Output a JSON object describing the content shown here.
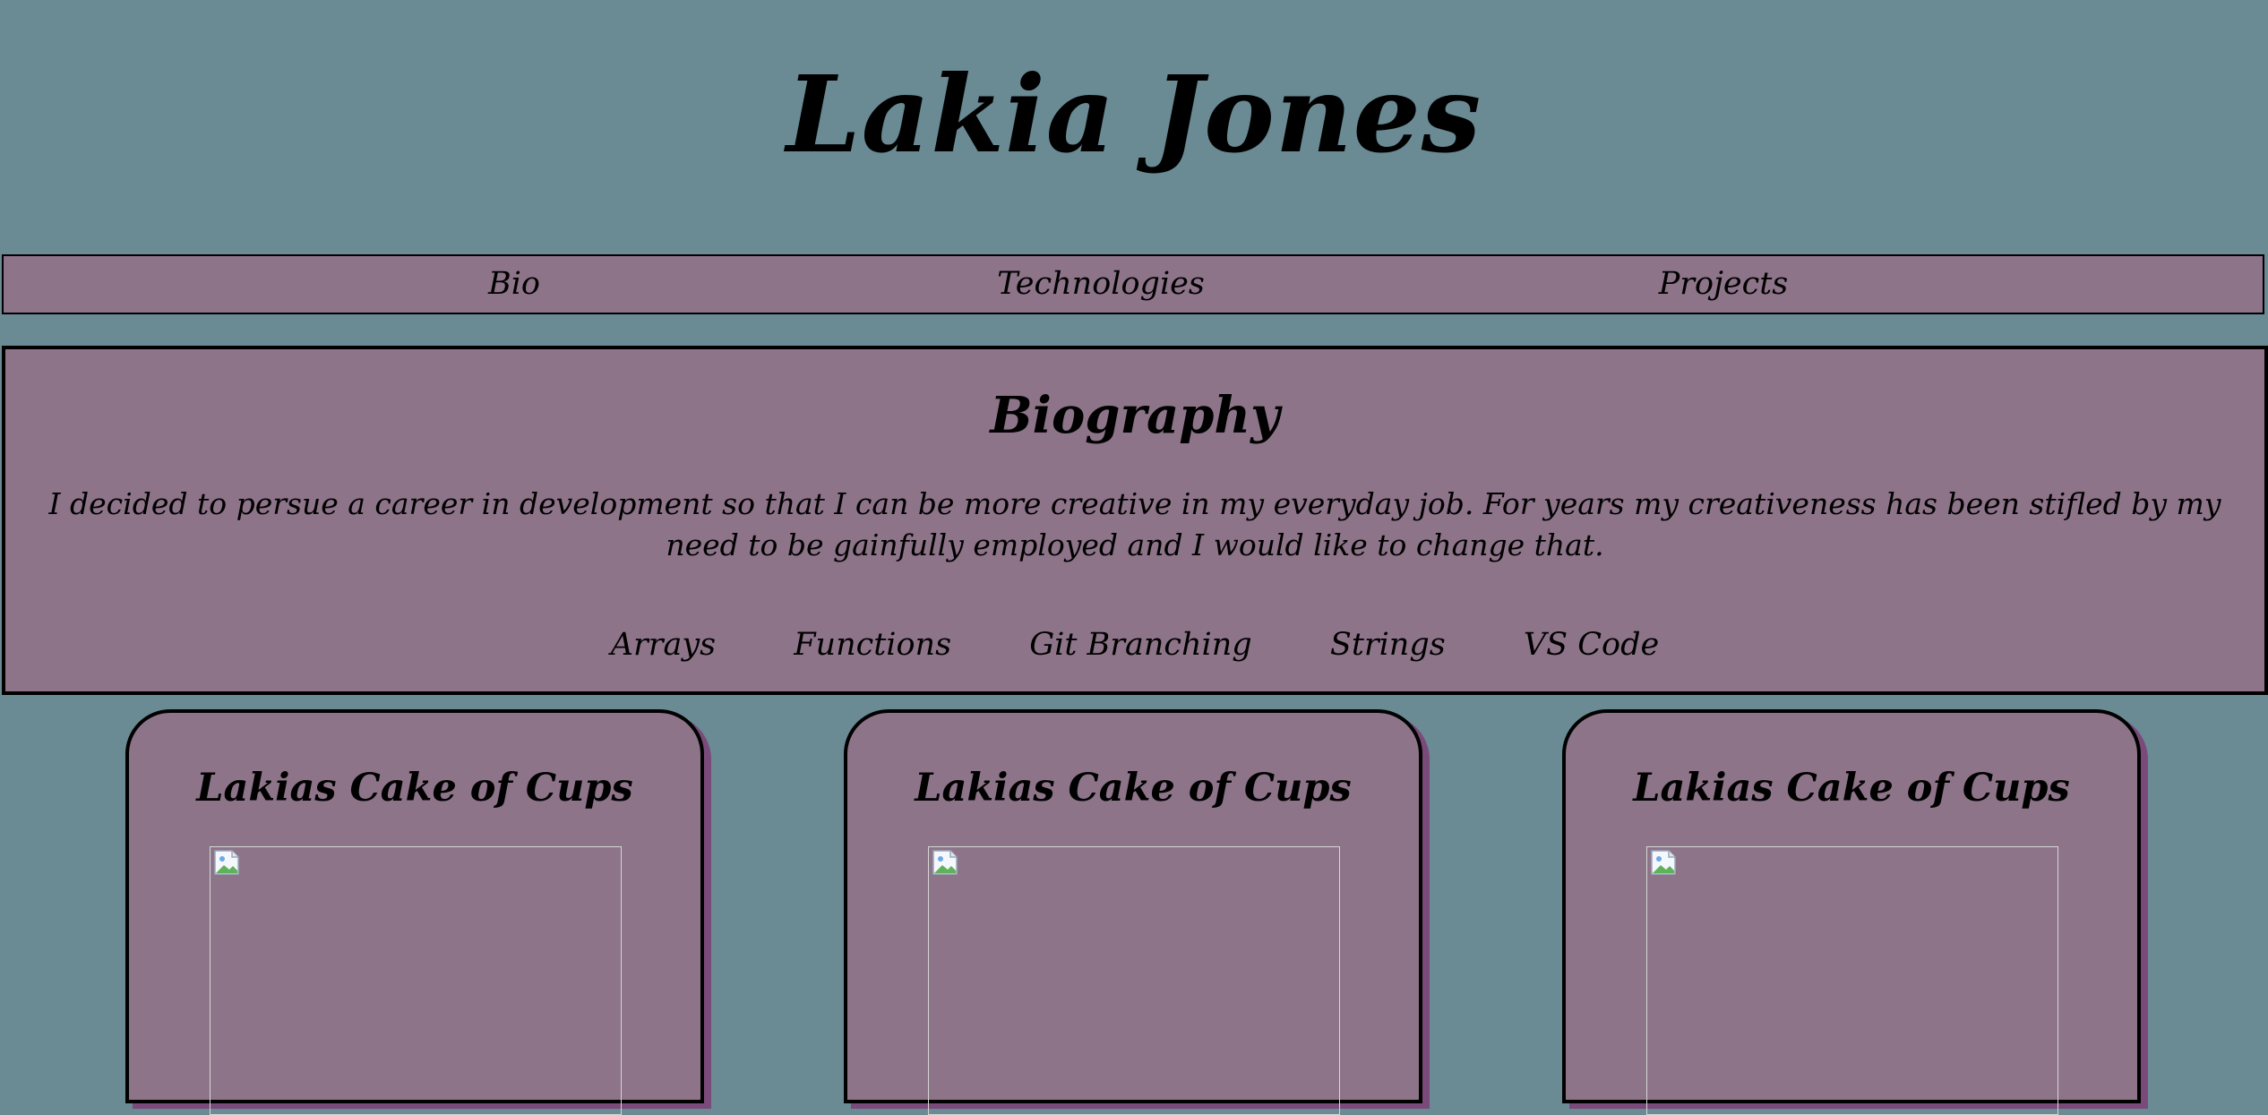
{
  "header": {
    "title": "Lakia Jones"
  },
  "nav": {
    "items": [
      {
        "label": "Bio"
      },
      {
        "label": "Technologies"
      },
      {
        "label": "Projects"
      }
    ]
  },
  "biography": {
    "heading": "Biography",
    "text": "I decided to persue a career in development so that I can be more creative in my everyday job. For years my creativeness has been stifled by my need to be gainfully employed and I would like to change that.",
    "technologies": [
      "Arrays",
      "Functions",
      "Git Branching",
      "Strings",
      "VS Code"
    ]
  },
  "projects": [
    {
      "title": "Lakias Cake of Cups",
      "image_icon": "broken-image-icon"
    },
    {
      "title": "Lakias Cake of Cups",
      "image_icon": "broken-image-icon"
    },
    {
      "title": "Lakias Cake of Cups",
      "image_icon": "broken-image-icon"
    }
  ],
  "colors": {
    "background": "#6a8a94",
    "panel": "#8d7489",
    "card_shadow": "#7a4b7a",
    "text": "#000000"
  }
}
